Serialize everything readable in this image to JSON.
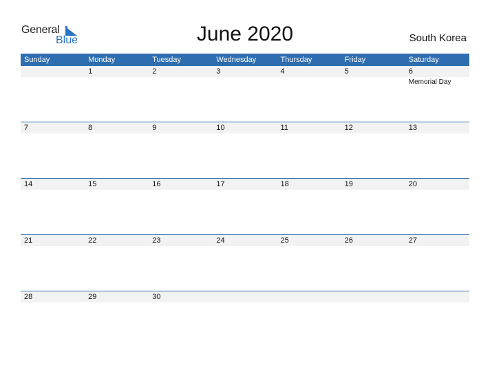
{
  "logo": {
    "line1": "General",
    "line2": "Blue"
  },
  "title": "June 2020",
  "country": "South Korea",
  "colors": {
    "accent": "#2e6db0",
    "row_bg": "#f2f2f2"
  },
  "weekdays": [
    "Sunday",
    "Monday",
    "Tuesday",
    "Wednesday",
    "Thursday",
    "Friday",
    "Saturday"
  ],
  "weeks": [
    {
      "days": [
        "",
        "1",
        "2",
        "3",
        "4",
        "5",
        "6"
      ],
      "events": [
        "",
        "",
        "",
        "",
        "",
        "",
        "Memorial Day"
      ]
    },
    {
      "days": [
        "7",
        "8",
        "9",
        "10",
        "11",
        "12",
        "13"
      ],
      "events": [
        "",
        "",
        "",
        "",
        "",
        "",
        ""
      ]
    },
    {
      "days": [
        "14",
        "15",
        "16",
        "17",
        "18",
        "19",
        "20"
      ],
      "events": [
        "",
        "",
        "",
        "",
        "",
        "",
        ""
      ]
    },
    {
      "days": [
        "21",
        "22",
        "23",
        "24",
        "25",
        "26",
        "27"
      ],
      "events": [
        "",
        "",
        "",
        "",
        "",
        "",
        ""
      ]
    },
    {
      "days": [
        "28",
        "29",
        "30",
        "",
        "",
        "",
        ""
      ],
      "events": [
        "",
        "",
        "",
        "",
        "",
        "",
        ""
      ]
    }
  ]
}
